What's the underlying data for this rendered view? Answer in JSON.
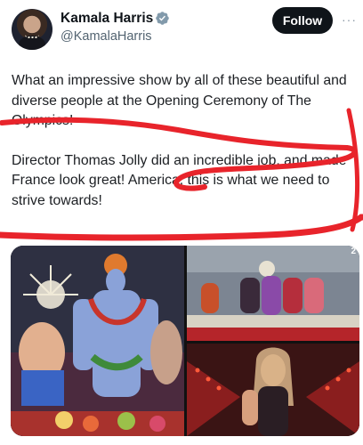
{
  "author": {
    "name": "Kamala Harris",
    "handle": "@KamalaHarris",
    "verified": true,
    "avatar_icon": "profile-photo"
  },
  "actions": {
    "follow_label": "Follow",
    "more_label": "···"
  },
  "tweet": {
    "paragraph1": "What an impressive show by all of these beautiful and diverse people at the Opening Ceremony of The Olympics!",
    "paragraph2": "Director Thomas Jolly did an incredible job, and made France look great! America, this is what we need to strive towards!"
  },
  "media": {
    "photo_count_badge": "2",
    "annotation_color": "#e8242b"
  },
  "colors": {
    "follow_bg": "#0f1419",
    "verified_badge": "#829aab",
    "handle_gray": "#536471"
  }
}
